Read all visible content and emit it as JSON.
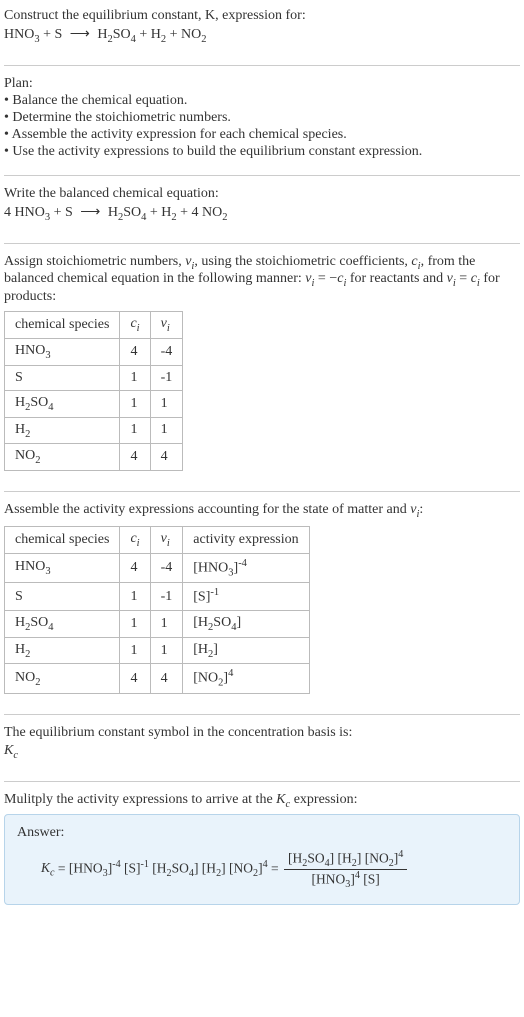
{
  "header": {
    "line1": "Construct the equilibrium constant, K, expression for:"
  },
  "plan": {
    "title": "Plan:",
    "b1": "• Balance the chemical equation.",
    "b2": "• Determine the stoichiometric numbers.",
    "b3": "• Assemble the activity expression for each chemical species.",
    "b4": "• Use the activity expressions to build the equilibrium constant expression."
  },
  "balance": {
    "label": "Write the balanced chemical equation:"
  },
  "assign": {
    "part1": "Assign stoichiometric numbers, ",
    "part2": ", using the stoichiometric coefficients, ",
    "part3": ", from the balanced chemical equation in the following manner: ",
    "part4": " for reactants and ",
    "part5": " for products:"
  },
  "table1": {
    "h1": "chemical species",
    "rows": [
      {
        "sp": "HNO3",
        "c": "4",
        "v": "-4"
      },
      {
        "sp": "S",
        "c": "1",
        "v": "-1"
      },
      {
        "sp": "H2SO4",
        "c": "1",
        "v": "1"
      },
      {
        "sp": "H2",
        "c": "1",
        "v": "1"
      },
      {
        "sp": "NO2",
        "c": "4",
        "v": "4"
      }
    ]
  },
  "assemble": {
    "part1": "Assemble the activity expressions accounting for the state of matter and "
  },
  "table2": {
    "h1": "chemical species",
    "h4": "activity expression",
    "rows": [
      {
        "c": "4",
        "v": "-4"
      },
      {
        "c": "1",
        "v": "-1"
      },
      {
        "c": "1",
        "v": "1"
      },
      {
        "c": "1",
        "v": "1"
      },
      {
        "c": "4",
        "v": "4"
      }
    ]
  },
  "symbol": {
    "line": "The equilibrium constant symbol in the concentration basis is:"
  },
  "multiply": {
    "part1": "Mulitply the activity expressions to arrive at the ",
    "part2": " expression:"
  },
  "answer": {
    "label": "Answer:"
  },
  "chart_data": {
    "type": "table",
    "title": "Stoichiometric numbers and activity expressions",
    "tables": [
      {
        "columns": [
          "chemical species",
          "c_i",
          "v_i"
        ],
        "rows": [
          [
            "HNO3",
            4,
            -4
          ],
          [
            "S",
            1,
            -1
          ],
          [
            "H2SO4",
            1,
            1
          ],
          [
            "H2",
            1,
            1
          ],
          [
            "NO2",
            4,
            4
          ]
        ]
      },
      {
        "columns": [
          "chemical species",
          "c_i",
          "v_i",
          "activity expression"
        ],
        "rows": [
          [
            "HNO3",
            4,
            -4,
            "[HNO3]^-4"
          ],
          [
            "S",
            1,
            -1,
            "[S]^-1"
          ],
          [
            "H2SO4",
            1,
            1,
            "[H2SO4]"
          ],
          [
            "H2",
            1,
            1,
            "[H2]"
          ],
          [
            "NO2",
            4,
            4,
            "[NO2]^4"
          ]
        ]
      }
    ],
    "reaction_unbalanced": "HNO3 + S -> H2SO4 + H2 + NO2",
    "reaction_balanced": "4 HNO3 + S -> H2SO4 + H2 + 4 NO2",
    "Kc": "([H2SO4][H2][NO2]^4) / ([HNO3]^4 [S])"
  }
}
